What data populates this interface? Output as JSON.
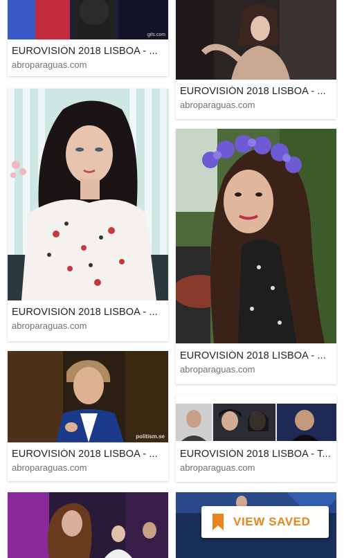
{
  "results": [
    {
      "title": "EUROVISIÓN 2018 LISBOA - ...",
      "source": "abroparaguas.com",
      "watermark": "gifs.com"
    },
    {
      "title": "EUROVISIÓN 2018 LISBOA - ...",
      "source": "abroparaguas.com",
      "watermark": ""
    },
    {
      "title": "EUROVISIÓN 2018 LISBOA - ...",
      "source": "abroparaguas.com",
      "watermark": ""
    },
    {
      "title": "EUROVISIÓN 2018 LISBOA - ...",
      "source": "abroparaguas.com",
      "watermark": ""
    },
    {
      "title": "EUROVISIÓN 2018 LISBOA - ...",
      "source": "abroparaguas.com",
      "watermark": "politism.se"
    },
    {
      "title": "EUROVISIÓN 2018 LISBOA - T...",
      "source": "abroparaguas.com",
      "watermark": ""
    },
    {
      "title": "",
      "source": "",
      "watermark": ""
    },
    {
      "title": "",
      "source": "",
      "watermark": ""
    }
  ],
  "view_saved": {
    "label": "VIEW SAVED",
    "icon": "bookmark-icon",
    "color": "#e8851c"
  }
}
